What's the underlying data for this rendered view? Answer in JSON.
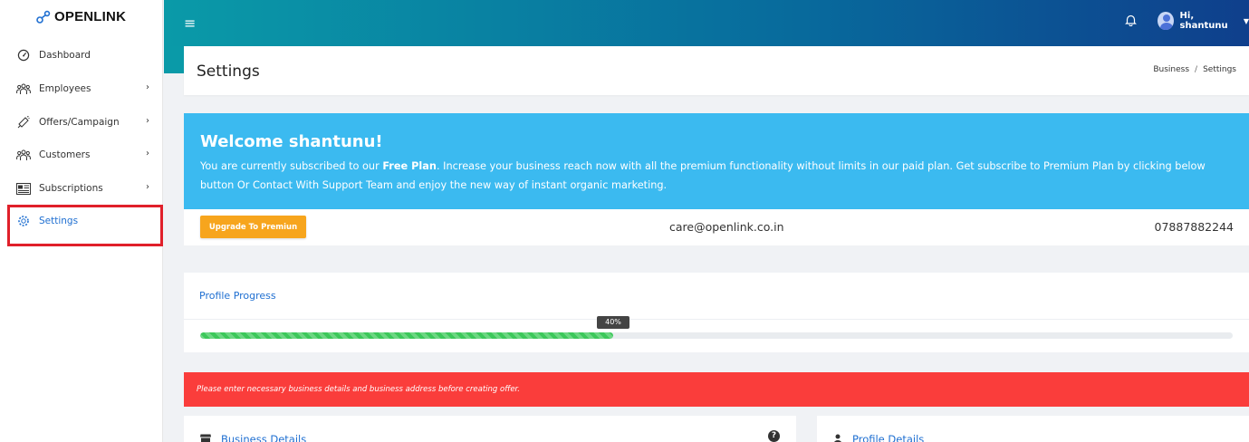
{
  "brand": {
    "logo_text": "OPENLINK"
  },
  "sidebar": {
    "items": [
      {
        "label": "Dashboard",
        "icon": "gauge-icon",
        "has_chevron": false
      },
      {
        "label": "Employees",
        "icon": "users-icon",
        "has_chevron": true
      },
      {
        "label": "Offers/Campaign",
        "icon": "megaphone-icon",
        "has_chevron": true
      },
      {
        "label": "Customers",
        "icon": "users-icon",
        "has_chevron": true
      },
      {
        "label": "Subscriptions",
        "icon": "subscriptions-icon",
        "has_chevron": true
      },
      {
        "label": "Settings",
        "icon": "gear-icon",
        "has_chevron": false,
        "active": true
      }
    ]
  },
  "topbar": {
    "menu_icon": "hamburger-icon",
    "notification_icon": "bell-icon",
    "user_greeting": "Hi, shantunu"
  },
  "header": {
    "title": "Settings",
    "breadcrumb": [
      "Business",
      "Settings"
    ]
  },
  "welcome": {
    "title": "Welcome shantunu!",
    "text_before": "You are currently subscribed to our ",
    "plan_name": "Free Plan",
    "text_after": ". Increase your business reach now with all the premium functionality without limits in our paid plan. Get subscribe to Premium Plan by clicking below button Or Contact With Support Team and enjoy the new way of instant organic marketing.",
    "upgrade_button": "Upgrade To Premiun",
    "email": "care@openlink.co.in",
    "phone": "07887882244"
  },
  "profile_progress": {
    "title": "Profile Progress",
    "percent_label": "40%",
    "percent": 40
  },
  "alert": {
    "message": "Please enter necessary business details and business address before creating offer."
  },
  "cards": {
    "business": {
      "label": "Business Details",
      "icon": "store-icon",
      "help_icon": "question-circle-icon"
    },
    "profile": {
      "label": "Profile Details",
      "icon": "user-icon"
    }
  },
  "colors": {
    "accent": "#1f6fd1",
    "welcome_bg": "#3bbaf0",
    "upgrade_button": "#f7a51d",
    "progress_fill": "#3cc85a",
    "alert_bg": "#fa3d3b",
    "topbar_start": "#0a9aa8",
    "topbar_end": "#0f3f8c"
  }
}
